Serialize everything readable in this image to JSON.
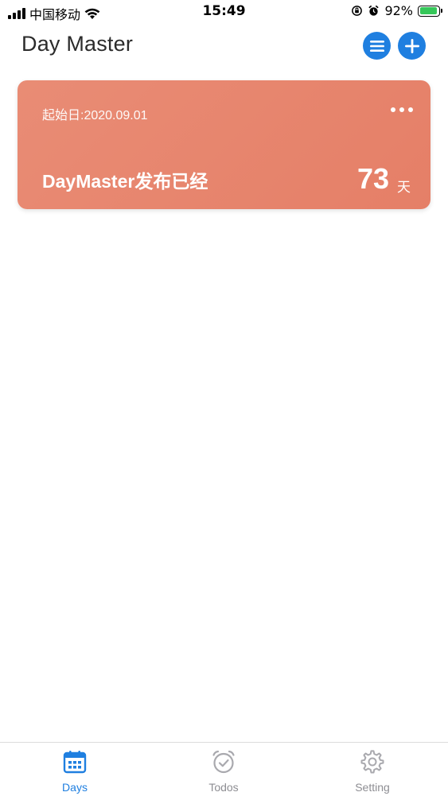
{
  "status_bar": {
    "carrier": "中国移动",
    "time": "15:49",
    "battery": "92%",
    "battery_level": 0.92
  },
  "header": {
    "title": "Day Master"
  },
  "cards": [
    {
      "start_label": "起始日:2020.09.01",
      "event": "DayMaster发布已经",
      "count": "73",
      "unit": "天",
      "color": "#e8866f"
    }
  ],
  "tab_bar": {
    "tabs": [
      {
        "label": "Days",
        "icon": "calendar-icon",
        "active": true
      },
      {
        "label": "Todos",
        "icon": "alarm-clock-icon",
        "active": false
      },
      {
        "label": "Setting",
        "icon": "gear-icon",
        "active": false
      }
    ]
  },
  "colors": {
    "accent": "#1f7fe0",
    "card": "#e8866f",
    "inactive": "#8e8e93"
  }
}
